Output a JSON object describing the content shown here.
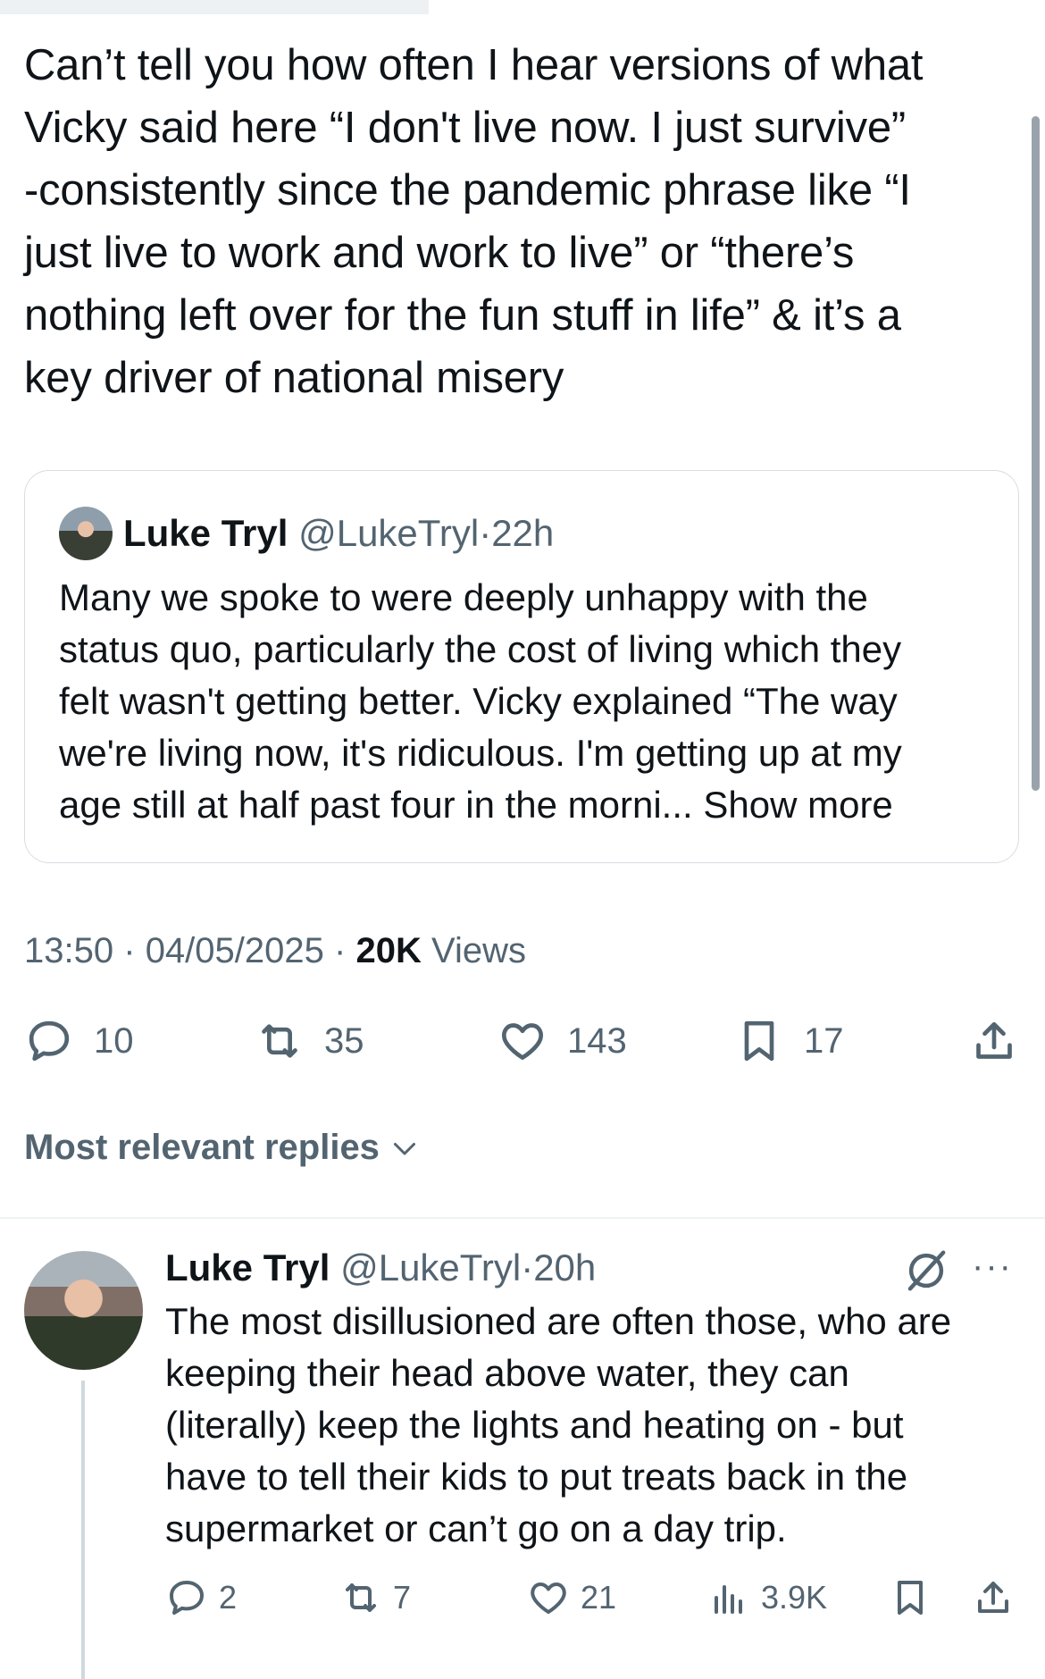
{
  "tweet": {
    "text_lines": [
      "Can’t tell you how often I hear versions of what",
      "Vicky said here “I don't live now. I just survive”",
      "-consistently since the pandemic phrase like “I",
      "just live to work and work to live” or “there’s",
      "nothing left over for the fun stuff in life” & it’s a",
      "key driver of national misery"
    ],
    "time": "13:50",
    "date": "04/05/2025",
    "views_count": "20K",
    "views_label": "Views",
    "separator": "·",
    "actions": {
      "replies": "10",
      "retweets": "35",
      "likes": "143",
      "bookmarks": "17"
    }
  },
  "quoted": {
    "name": "Luke Tryl",
    "handle": "@LukeTryl",
    "age": "22h",
    "separator": "·",
    "text_lines": [
      "Many we spoke to were deeply unhappy with the",
      "status quo, particularly the cost of living which they",
      "felt wasn't getting better. Vicky explained “The way",
      "we're living now, it's ridiculous. I'm getting up at my",
      "age still at half past four in the morni... "
    ],
    "show_more": "Show more"
  },
  "replies_sort": {
    "label": "Most relevant replies"
  },
  "reply": {
    "name": "Luke Tryl",
    "handle": "@LukeTryl",
    "age": "20h",
    "separator": "·",
    "more": "···",
    "text_lines": [
      "The most disillusioned are often those, who are",
      "keeping their head above water, they can",
      "(literally) keep the lights and heating on - but",
      "have to tell their kids to put treats back in the",
      "supermarket or can’t go on a day trip."
    ],
    "actions": {
      "replies": "2",
      "retweets": "7",
      "likes": "21",
      "views": "3.9K"
    }
  },
  "icons": {
    "reply": "reply-icon",
    "retweet": "retweet-icon",
    "like": "heart-icon",
    "bookmark": "bookmark-icon",
    "share": "share-icon",
    "views": "views-icon",
    "grok": "grok-icon",
    "chevron": "chevron-down-icon"
  },
  "colors": {
    "text": "#0f1419",
    "muted": "#536471",
    "border": "#d8dde2"
  }
}
